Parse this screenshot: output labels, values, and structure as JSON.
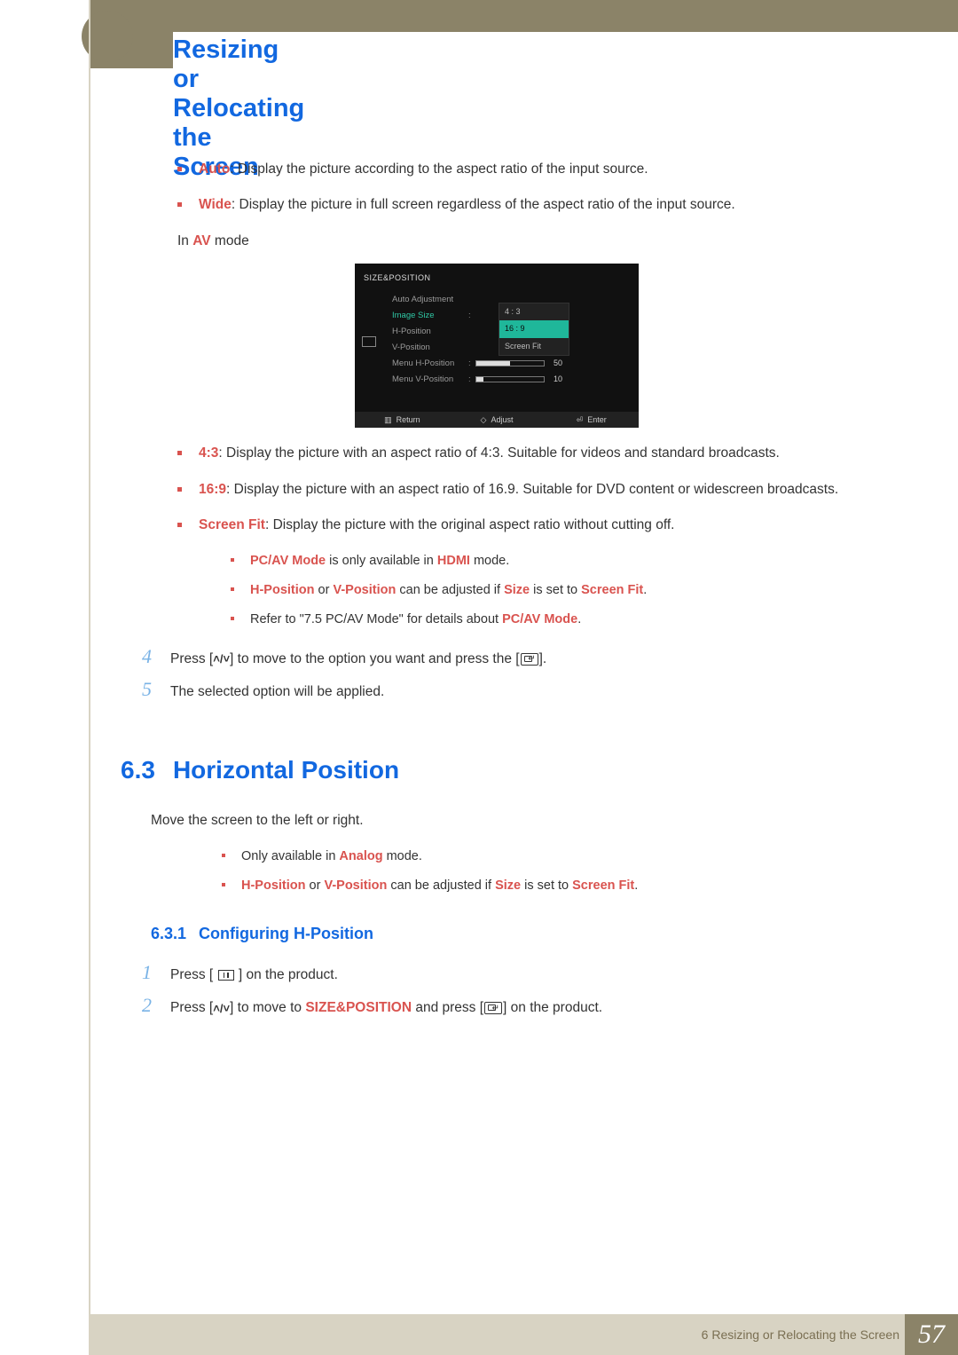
{
  "header": {
    "title": "Resizing or Relocating the Screen"
  },
  "bullets_top": [
    {
      "label": "Auto",
      "text": ": Display the picture according to the aspect ratio of the input source."
    },
    {
      "label": "Wide",
      "text": ": Display the picture in full screen regardless of the aspect ratio of the input source."
    }
  ],
  "in_av_line": {
    "prefix": "In ",
    "mode": "AV",
    "suffix": " mode"
  },
  "osd": {
    "title": "SIZE&POSITION",
    "rows": {
      "auto_adjustment": "Auto Adjustment",
      "image_size": "Image Size",
      "h_position": "H-Position",
      "v_position": "V-Position",
      "menu_h_position": {
        "label": "Menu H-Position",
        "value": "50",
        "fill": 50
      },
      "menu_v_position": {
        "label": "Menu V-Position",
        "value": "10",
        "fill": 10
      }
    },
    "dropdown": [
      "4 : 3",
      "16 : 9",
      "Screen Fit"
    ],
    "dropdown_selected_index": 1,
    "footer": {
      "return": "Return",
      "adjust": "Adjust",
      "enter": "Enter"
    }
  },
  "bullets_mid": [
    {
      "label": "4:3",
      "text": ": Display the picture with an aspect ratio of 4:3. Suitable for videos and standard broadcasts."
    },
    {
      "label": "16:9",
      "text": ": Display the picture with an aspect ratio of 16.9. Suitable for DVD content or widescreen broadcasts."
    },
    {
      "label": "Screen Fit",
      "text": ": Display the picture with the original aspect ratio without cutting off."
    }
  ],
  "notes_mid": {
    "n1": {
      "a": "PC/AV Mode",
      "b": " is only available in ",
      "c": "HDMI",
      "d": " mode."
    },
    "n2": {
      "a": "H-Position",
      "b": " or ",
      "c": "V-Position",
      "d": " can be adjusted if ",
      "e": "Size",
      "f": " is set to ",
      "g": "Screen Fit",
      "h": "."
    },
    "n3": {
      "a": "Refer to \"7.5 PC/AV Mode\" for details about ",
      "b": "PC/AV Mode",
      "c": "."
    }
  },
  "steps_top": {
    "s4": {
      "num": "4",
      "pre": "Press [",
      "mid": "] to move to the option you want and press the [",
      "post": "]."
    },
    "s5": {
      "num": "5",
      "text": "The selected option will be applied."
    }
  },
  "section63": {
    "num": "6.3",
    "title": "Horizontal Position",
    "intro": "Move the screen to the left or right.",
    "notes": {
      "n1": {
        "a": "Only available in ",
        "b": "Analog",
        "c": " mode."
      },
      "n2": {
        "a": "H-Position",
        "b": " or ",
        "c": "V-Position",
        "d": " can be adjusted if ",
        "e": "Size",
        "f": " is set to ",
        "g": "Screen Fit",
        "h": "."
      }
    },
    "sub": {
      "num": "6.3.1",
      "title": "Configuring H-Position"
    },
    "steps": {
      "s1": {
        "num": "1",
        "pre": "Press [ ",
        "post": " ] on the product."
      },
      "s2": {
        "num": "2",
        "pre": "Press [",
        "mid1": "] to move to ",
        "kw": "SIZE&POSITION",
        "mid2": " and press [",
        "post": "] on the product."
      }
    }
  },
  "footer": {
    "chapter": "6 Resizing or Relocating the Screen",
    "page": "57"
  }
}
